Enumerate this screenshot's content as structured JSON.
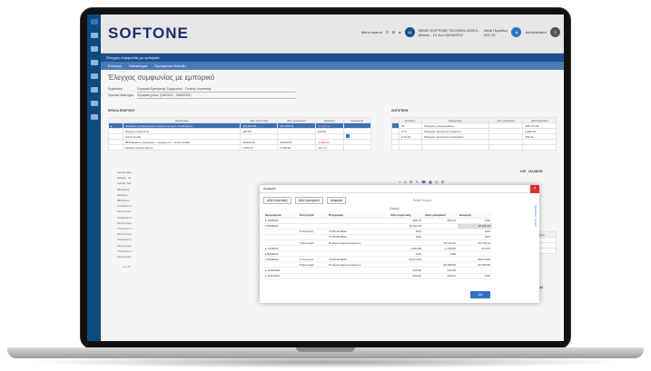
{
  "topbar": {
    "logo": "SOFTONE",
    "menu_search": "Menu search",
    "company": "DEMO SOFTONE TECHNOLOGIES...",
    "company_sub": "Athens - 13 Jun 10/06/2022",
    "branch": "Modi Περίοδος",
    "branch_sub": "ΕΟΙ 22",
    "user": "Administrator",
    "badge": "11"
  },
  "tab": {
    "label": "Έλεγχος συμφωνίας με εμπορικό"
  },
  "toolbar": {
    "items": [
      "Επιλογή",
      "Παλαιότερα",
      "Προτιμώσα διάταξη"
    ]
  },
  "page": {
    "title": "Έλεγχος συμφωνίας με εμπορικό",
    "filter1_label": "Εμφάνιση:",
    "filter1_value": "Συγκριτά Εμπορικής Συμφωνίας - Γενικής Λογιστικής",
    "filter2_label": "Χρονικό διάστημα:",
    "filter2_value": "Σύγκριση μέσω (1/6/2022 - 30/6/2022)"
  },
  "left": {
    "section": "ΦΥΛΛΑ ΕΛΕΓΧΟΥ",
    "headers": [
      "Περιγραφή",
      "Αξία λογιστικής",
      "Αξία εμπορικού",
      "Διαφορά",
      "Συμφωνία"
    ],
    "rows": [
      [
        "Πωλήσεις εμπορευμάτων-προϊόντων-λοιπ. αποθεμάτων",
        "112,463.33",
        "127,078.44",
        "-14,615.11",
        ""
      ],
      [
        "Παροχή υπηρεσιών",
        "120.00",
        "",
        "120.00",
        ""
      ],
      [
        "Λοιπά έσοδα",
        "",
        "",
        "",
        ""
      ],
      [
        "ΦΠΑ Εκροών (πωλήσεις - παροχή υπ. - λοιπά έσοδα)",
        "26,046.81",
        "29,030.07",
        "-2,983.46",
        ""
      ],
      [
        "Αγορές εμπορευμάτων",
        "1,972.71",
        "2,798.90",
        "-821.21",
        ""
      ]
    ],
    "more_rows": [
      "Αγορές Εμπ",
      "Αγορές - Αγ",
      "Αγορές παγ",
      "ΦΠΑ Εισρ",
      "Δαπάνες",
      "ΦΠΑ Εισρ",
      "Υπόλοιπο π",
      "Κίνηση πελ",
      "Υπόλοιπο π",
      "Κίνηση προ",
      "Υπόλοιπο α",
      "Κίνηση προ",
      "Υπόλοιπο π",
      "Κίνηση παγ",
      "Υπόλοιπο π",
      "Κίνηση παγ"
    ],
    "pager": "1 of 27"
  },
  "right": {
    "section": "ΛΟΓΙΣΤΙΚΗ",
    "headers": [
      "Κωδικός",
      "Περιγραφή",
      "Από μεταφορά",
      "Αξία περιόδου"
    ],
    "rows": [
      [
        "70",
        "Πωλήσεις εμπορευμάτων",
        "",
        "106,712.96"
      ],
      [
        "2.77",
        "Πωλήσεις προϊόντων ετοίμων ε",
        "",
        "2,240.31"
      ],
      [
        "2.72.24",
        "Πωλήσεις προϊόντων και βοηθητι",
        "",
        "451.01"
      ]
    ],
    "total1": "112,463.82",
    "zero1": "0.00",
    "headers2": [
      "Περιγραφή",
      "Από μεταφορά",
      "Αξία περιόδου"
    ],
    "row2": [
      "Πωλήσεις Εμπορευμάτων",
      "",
      "127,078.44"
    ],
    "zero2": "0.00",
    "total2": "127,078.44"
  },
  "modal": {
    "title": "Διαφορές",
    "tags": [
      "Αξία λογιστικής",
      "Αξία εμπορικού",
      "Διαφορά"
    ],
    "fields_label": "Πεδία Στηλών",
    "sums_label": "Σύνολα",
    "side_tab": "Προσθήκη πεδίου",
    "ok": "OK",
    "headers": [
      "Ημερομηνία",
      "Κατηγορία",
      "Περιγραφή",
      "Αξία λογιστικής",
      "Αξία εμπορικού",
      "Διαφορά"
    ],
    "rows": [
      [
        "▸ 1/6/2022",
        "",
        "",
        "250.74",
        "250.74",
        "0.00"
      ],
      [
        "▾ 6/6/2022",
        "",
        "",
        "10,211.49",
        "",
        "10,211.49"
      ],
      [
        "",
        "▾ Λογιστική",
        "70.00.00.0024",
        "8.63",
        "",
        "8.63"
      ],
      [
        "",
        "",
        "71.00.00.0024",
        "8.63",
        "",
        "8.63"
      ],
      [
        "",
        "▾ Εμπορικό",
        "Πωλήσεις Εμπορευμάτων",
        "",
        "10,715.12",
        "-10,715.12"
      ],
      [
        "▸ 7/6/2022",
        "",
        "",
        "1,361.89",
        "1,735.86",
        "-373.97"
      ],
      [
        "▸ 8/6/2022",
        "",
        "",
        "0.90",
        "0.90",
        ""
      ],
      [
        "▾ 9/6/2022",
        "▾ Λογιστική",
        "70.00.00.0024",
        "29,974.06",
        "",
        "29,974.06"
      ],
      [
        "",
        "▾ Εμπορικό",
        "Πωλήσεις Εμπορευμάτων",
        "",
        "30,186.66",
        "-30,186.66"
      ],
      [
        "▸ 10/6/2022",
        "",
        "",
        "415.28",
        "415.28",
        ""
      ],
      [
        "▸ 11/6/2022",
        "",
        "",
        "100.62",
        "100.62",
        "0.00"
      ]
    ]
  }
}
